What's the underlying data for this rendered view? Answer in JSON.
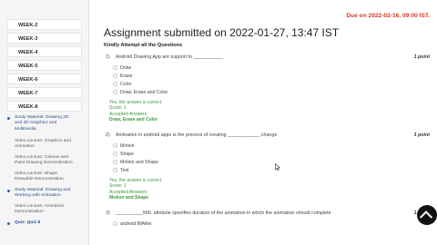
{
  "sidebar": {
    "weeks": [
      "WEEK-2",
      "WEEK-3",
      "WEEK-4",
      "WEEK-5",
      "WEEK-6",
      "WEEK-7",
      "WEEK-8"
    ],
    "items": [
      {
        "lines": [
          "Study Material: Drawing 2D",
          "and 3D Graphics and",
          "Multimedia"
        ],
        "dot": true
      },
      {
        "lines": [
          "Video Lecture: Graphics and",
          "Animation"
        ],
        "dot": false
      },
      {
        "lines": [
          "Video Lecture: Canvas and",
          "Paint Drawing Demonstration"
        ],
        "dot": false
      },
      {
        "lines": [
          "Video Lecture: Shape",
          "Drawable Demonstration"
        ],
        "dot": false
      },
      {
        "lines": [
          "Study Material: Drawing and",
          "Working with Animation"
        ],
        "dot": true
      },
      {
        "lines": [
          "Video Lecture: Animation",
          "Demonstration"
        ],
        "dot": false
      },
      {
        "lines": [
          "Quiz: Quiz 8"
        ],
        "dot": true
      }
    ]
  },
  "header": {
    "due": "Due on 2022-02-16, 09:00 IST.",
    "title": "Assignment submitted on 2022-01-27, 13:47 IST",
    "instruction": "Kindly Attempt all the Questions"
  },
  "questions": [
    {
      "num": "1)",
      "text": "Android Drawing App are support to ___________",
      "points": "1 point",
      "options": [
        "Draw",
        "Erase",
        "Color",
        "Draw, Erase and Color"
      ],
      "selected": 3,
      "feedback": [
        "Yes, the answer is correct.",
        "Score: 1",
        "Accepted Answers:",
        "Draw, Erase and Color"
      ]
    },
    {
      "num": "2)",
      "text": "Animation in android apps is the process of creating ____________ change",
      "points": "1 point",
      "options": [
        "Motion",
        "Shape",
        "Motion and Shape",
        "Text"
      ],
      "selected": 2,
      "feedback": [
        "Yes, the answer is correct.",
        "Score: 1",
        "Accepted Answers:",
        "Motion and Shape"
      ]
    },
    {
      "num": "3)",
      "text": "__________XML attribute specifies duration of the animation in which the animation should complete",
      "points": "1 point",
      "options": [
        "android:fillAfter"
      ],
      "selected": -1,
      "feedback": []
    }
  ],
  "colors": {
    "due": "#d9361f",
    "correct": "#3c9a3c",
    "sidebar_bg": "#f5f5f5",
    "link": "#1f4fa6"
  }
}
